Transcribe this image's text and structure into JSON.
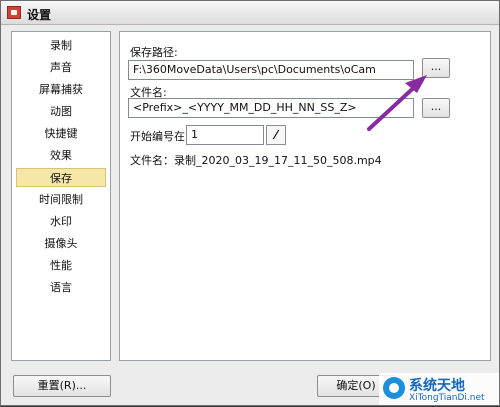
{
  "window": {
    "title": "设置"
  },
  "sidebar": {
    "items": [
      {
        "label": "录制"
      },
      {
        "label": "声音"
      },
      {
        "label": "屏幕捕获"
      },
      {
        "label": "动图"
      },
      {
        "label": "快捷键"
      },
      {
        "label": "效果"
      },
      {
        "label": "保存",
        "selected": true
      },
      {
        "label": "时间限制"
      },
      {
        "label": "水印"
      },
      {
        "label": "摄像头"
      },
      {
        "label": "性能"
      },
      {
        "label": "语言"
      }
    ]
  },
  "save": {
    "path_label": "保存路径:",
    "path_value": "F:\\360MoveData\\Users\\pc\\Documents\\oCam",
    "browse_label": "...",
    "filename_label": "文件名:",
    "filename_value": "<Prefix>_<YYYY_MM_DD_HH_NN_SS_Z>",
    "filename_btn_label": "...",
    "start_number_label": "开始编号在:",
    "start_number_value": "1",
    "start_number_toggle": "⁄",
    "preview": "文件名：录制_2020_03_19_17_11_50_508.mp4"
  },
  "footer": {
    "reset_label": "重置(R)...",
    "ok_label": "确定(O)"
  },
  "watermark": {
    "title": "系统天地",
    "subtitle": "XiTongTianDi.net"
  },
  "colors": {
    "selected_bg": "#f7e7a7",
    "arrow": "#8a2aa0"
  }
}
